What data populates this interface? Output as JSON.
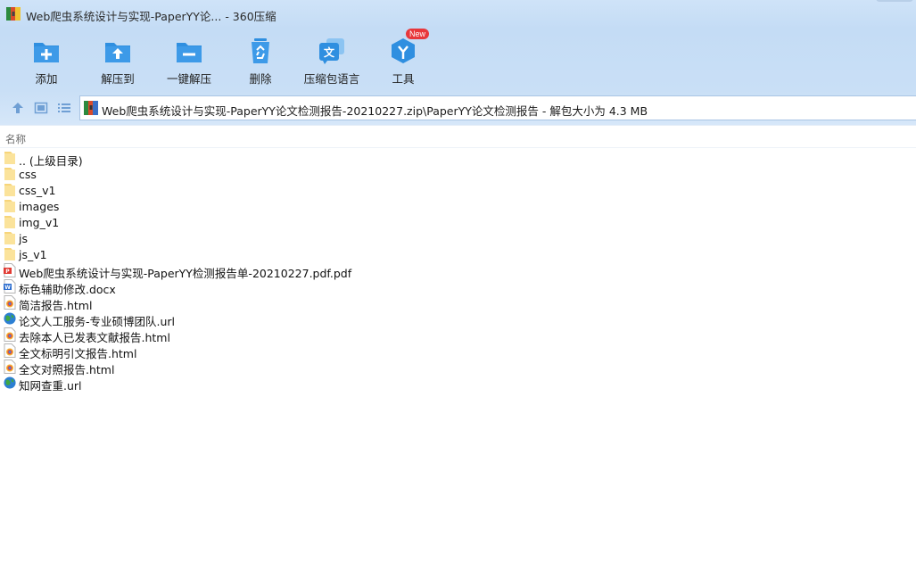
{
  "window": {
    "title": "Web爬虫系统设计与实现-PaperYY论...  - 360压缩",
    "icon": "archive-icon"
  },
  "toolbar": {
    "buttons": [
      {
        "label": "添加",
        "icon": "add-folder-icon"
      },
      {
        "label": "解压到",
        "icon": "extract-folder-icon"
      },
      {
        "label": "一键解压",
        "icon": "one-click-extract-icon"
      },
      {
        "label": "删除",
        "icon": "recycle-bin-icon"
      },
      {
        "label": "压缩包语言",
        "icon": "language-icon"
      },
      {
        "label": "工具",
        "icon": "tools-icon"
      }
    ],
    "new_badge": "New",
    "accent": "#2f8fe0"
  },
  "address": {
    "path": "Web爬虫系统设计与实现-PaperYY论文检测报告-20210227.zip\\PaperYY论文检测报告 - 解包大小为 4.3 MB",
    "nav": [
      "up-arrow-icon",
      "thumbnail-view-icon",
      "list-view-icon"
    ]
  },
  "list": {
    "column_name": "名称",
    "items": [
      {
        "name": ".. (上级目录)",
        "type": "folder"
      },
      {
        "name": "css",
        "type": "folder"
      },
      {
        "name": "css_v1",
        "type": "folder"
      },
      {
        "name": "images",
        "type": "folder"
      },
      {
        "name": "img_v1",
        "type": "folder"
      },
      {
        "name": "js",
        "type": "folder"
      },
      {
        "name": "js_v1",
        "type": "folder"
      },
      {
        "name": "Web爬虫系统设计与实现-PaperYY检测报告单-20210227.pdf.pdf",
        "type": "pdf"
      },
      {
        "name": "标色辅助修改.docx",
        "type": "docx"
      },
      {
        "name": "简洁报告.html",
        "type": "html"
      },
      {
        "name": "论文人工服务-专业硕博团队.url",
        "type": "url"
      },
      {
        "name": "去除本人已发表文献报告.html",
        "type": "html"
      },
      {
        "name": "全文标明引文报告.html",
        "type": "html"
      },
      {
        "name": "全文对照报告.html",
        "type": "html"
      },
      {
        "name": "知网查重.url",
        "type": "url"
      }
    ]
  }
}
